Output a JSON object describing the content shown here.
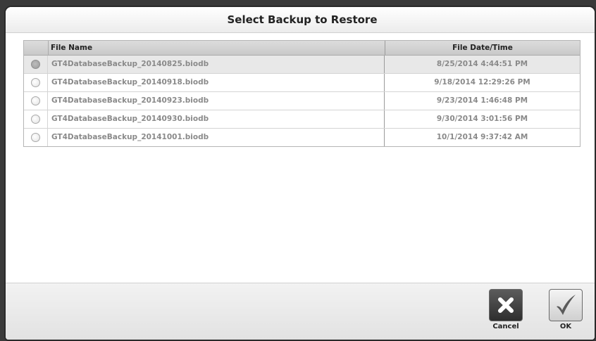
{
  "dialog": {
    "title": "Select Backup to Restore"
  },
  "table": {
    "columns": {
      "name": "File Name",
      "date": "File Date/Time"
    },
    "selected_index": 0,
    "rows": [
      {
        "name": "GT4DatabaseBackup_20140825.biodb",
        "date": "8/25/2014 4:44:51 PM",
        "selected": true
      },
      {
        "name": "GT4DatabaseBackup_20140918.biodb",
        "date": "9/18/2014 12:29:26 PM",
        "selected": false
      },
      {
        "name": "GT4DatabaseBackup_20140923.biodb",
        "date": "9/23/2014 1:46:48 PM",
        "selected": false
      },
      {
        "name": "GT4DatabaseBackup_20140930.biodb",
        "date": "9/30/2014 3:01:56 PM",
        "selected": false
      },
      {
        "name": "GT4DatabaseBackup_20141001.biodb",
        "date": "10/1/2014 9:37:42 AM",
        "selected": false
      }
    ]
  },
  "footer": {
    "cancel_label": "Cancel",
    "ok_label": "OK",
    "cancel_icon": "close-x-icon",
    "ok_icon": "checkmark-icon"
  }
}
